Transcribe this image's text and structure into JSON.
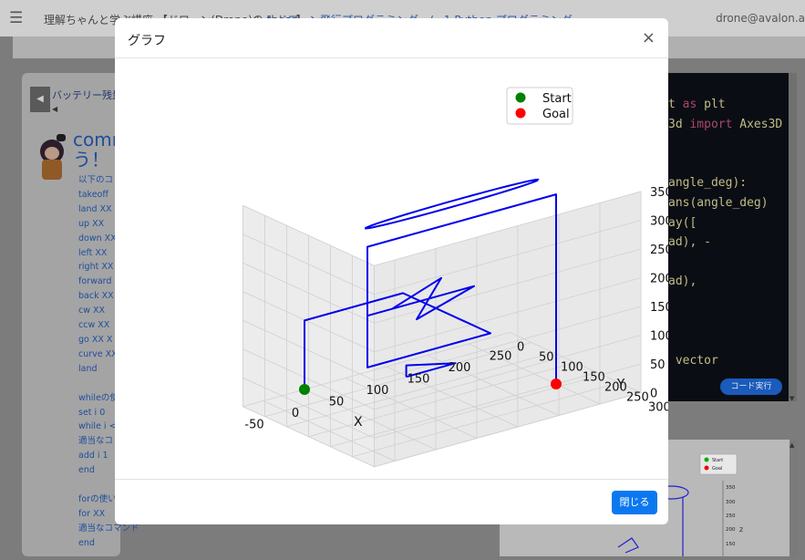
{
  "header": {
    "menu_icon": "hamburger-icon",
    "app_title": "理解ちゃんと学ぶ講座 【ドローン(Drone)の theor】",
    "breadcrumb": "1.ドローン飛行プログラミング　/　1.Python プログラミング",
    "user_email": "drone@avalon.a"
  },
  "left_panel": {
    "battery_label": "バッテリー残量",
    "heading": "comm\nう！",
    "commands": [
      "以下のコ",
      "takeoff",
      "land XX",
      "up XX",
      "down XX",
      "left XX",
      "right XX",
      "forward",
      "back XX",
      "cw XX",
      "ccw XX",
      "go XX X",
      "curve XX",
      "land",
      "",
      "whileの使",
      "set i 0",
      "while i <",
      "適当なコ",
      "add i 1",
      "end",
      "",
      "forの使い",
      "for XX",
      "適当なコマンド",
      "end"
    ]
  },
  "code_panel": {
    "lines": [
      {
        "pre": "t ",
        "kw": "as",
        "post": " plt"
      },
      {
        "pre": "3d ",
        "kw": "import",
        "post": " Axes3D"
      },
      {
        "pre": "",
        "kw": "",
        "post": ""
      },
      {
        "pre": "",
        "kw": "",
        "post": ""
      },
      {
        "pre": "angle_deg):",
        "kw": "",
        "post": ""
      },
      {
        "pre": "ans(angle_deg)",
        "kw": "",
        "post": ""
      },
      {
        "pre": "ay([",
        "kw": "",
        "post": ""
      },
      {
        "pre": "ad), -",
        "kw": "",
        "post": ""
      },
      {
        "pre": "",
        "kw": "",
        "post": ""
      },
      {
        "pre": "ad),",
        "kw": "",
        "post": ""
      },
      {
        "pre": "",
        "kw": "",
        "post": ""
      },
      {
        "pre": "",
        "kw": "",
        "post": ""
      },
      {
        "pre": "",
        "kw": "",
        "post": ""
      },
      {
        "pre": " vector",
        "kw": "",
        "post": ""
      }
    ],
    "run_button": "コード実行"
  },
  "modal": {
    "title": "グラフ",
    "close_icon": "×",
    "close_button": "閉じる"
  },
  "chart_data": {
    "type": "line",
    "projection": "3d",
    "series": [
      {
        "color": "#0000ee",
        "points": [
          [
            0,
            0,
            0
          ],
          [
            0,
            0,
            120
          ],
          [
            120,
            0,
            120
          ],
          [
            120,
            200,
            120
          ],
          [
            -30,
            200,
            120
          ],
          [
            -30,
            200,
            210
          ],
          [
            100,
            200,
            210
          ],
          [
            30,
            200,
            180
          ],
          [
            60,
            200,
            240
          ],
          [
            0,
            200,
            210
          ],
          [
            -30,
            200,
            210
          ],
          [
            -30,
            200,
            330
          ],
          [
            200,
            200,
            330
          ],
          [
            200,
            200,
            0
          ]
        ]
      },
      {
        "color": "#0000ee",
        "points": [
          [
            60,
            120,
            40
          ],
          [
            120,
            120,
            40
          ],
          [
            60,
            120,
            60
          ],
          [
            60,
            120,
            40
          ]
        ]
      }
    ],
    "start": {
      "x": 0,
      "y": 0,
      "z": 0,
      "color": "#008000"
    },
    "goal": {
      "x": 200,
      "y": 200,
      "z": 0,
      "color": "#ff0000"
    },
    "legend": [
      {
        "label": "Start",
        "color": "#008000"
      },
      {
        "label": "Goal",
        "color": "#ff0000"
      }
    ],
    "legend_position": "top-right",
    "xlabel": "X",
    "ylabel": "Y",
    "zlabel": "Z",
    "xticks": [
      "-50",
      "0",
      "50",
      "100",
      "150",
      "200",
      "250"
    ],
    "yticks": [
      "0",
      "50",
      "100",
      "150",
      "200",
      "250",
      "300"
    ],
    "zticks": [
      "0",
      "50",
      "100",
      "150",
      "200",
      "250",
      "300",
      "350"
    ],
    "xlim": [
      -75,
      250
    ],
    "ylim": [
      0,
      300
    ],
    "zlim": [
      0,
      350
    ],
    "grid": true
  },
  "mini_chart": {
    "legend": [
      "Start",
      "Goal"
    ],
    "zticks": [
      "350",
      "300",
      "250",
      "200",
      "150"
    ],
    "zlabel": "Z"
  }
}
